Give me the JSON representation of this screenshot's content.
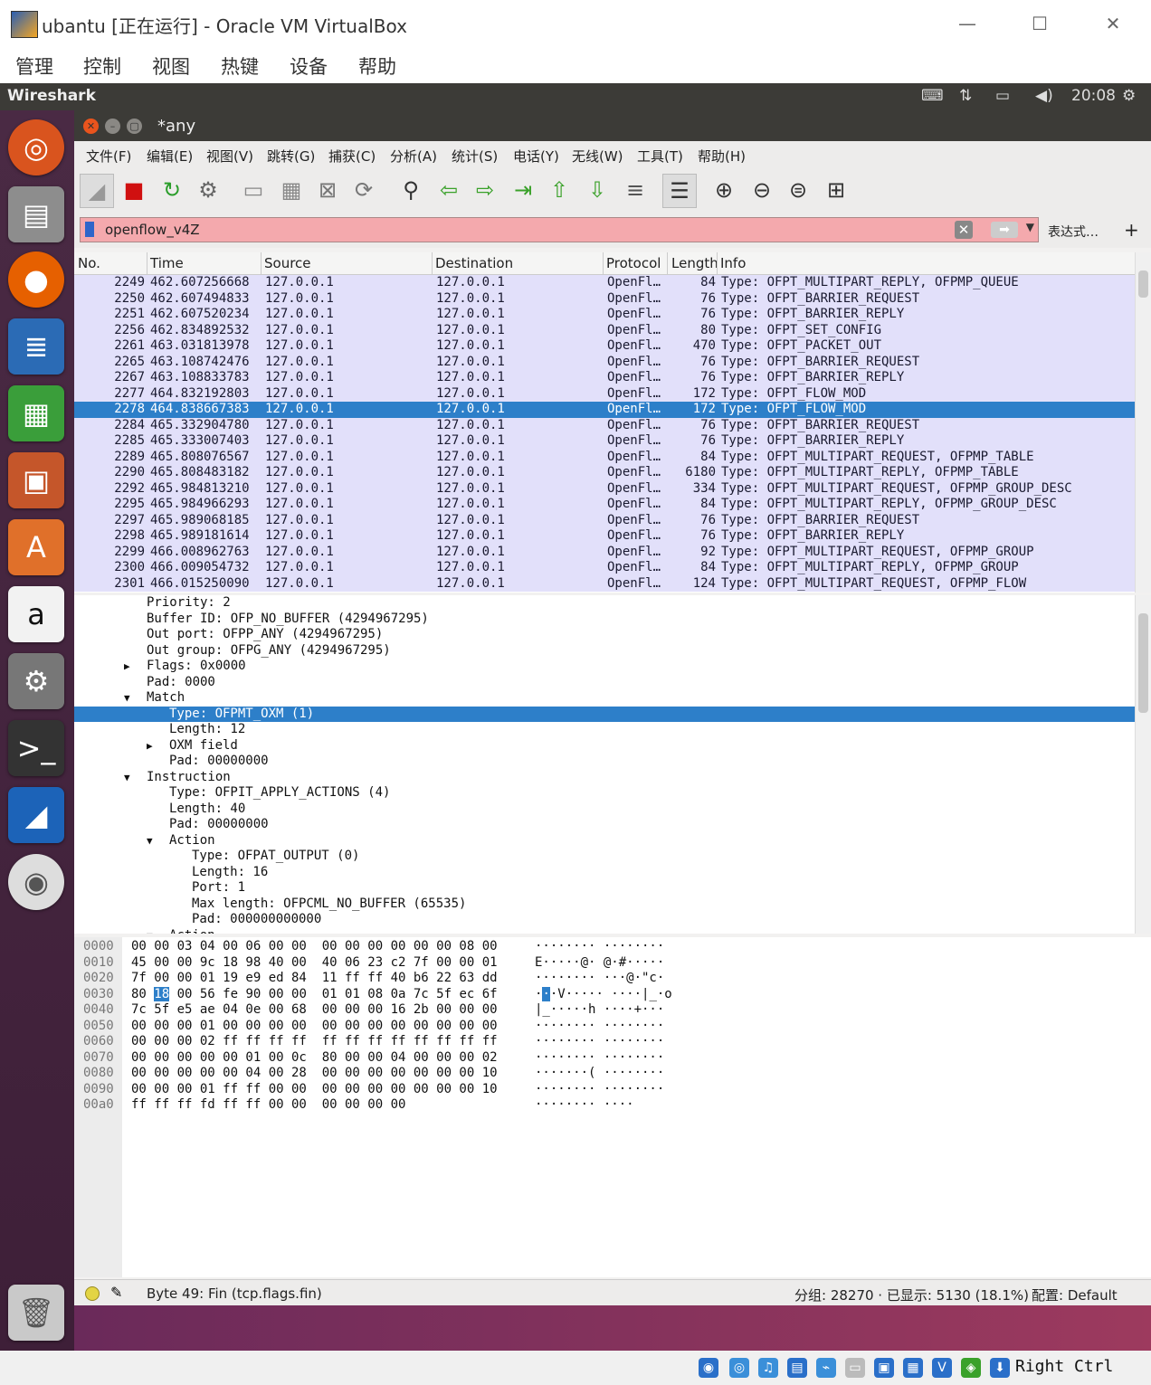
{
  "vbox": {
    "title": "ubantu [正在运行] - Oracle VM VirtualBox",
    "menu": [
      "管理",
      "控制",
      "视图",
      "热键",
      "设备",
      "帮助"
    ],
    "min": "—",
    "max": "☐",
    "close": "✕",
    "host_key": "Right Ctrl"
  },
  "ubuntu_panel": {
    "app_name": "Wireshark",
    "clock": "20:08",
    "indicators": [
      "keyboard-icon",
      "network-icon",
      "battery-icon",
      "volume-icon",
      "settings-icon"
    ]
  },
  "launcher": [
    "ubuntu-dash-icon",
    "files-icon",
    "firefox-icon",
    "writer-icon",
    "calc-icon",
    "impress-icon",
    "software-center-icon",
    "amazon-icon",
    "system-settings-icon",
    "terminal-icon",
    "wireshark-icon",
    "dvd-icon",
    "trash-icon"
  ],
  "wireshark": {
    "title": "*any",
    "menu": [
      "文件(F)",
      "编辑(E)",
      "视图(V)",
      "跳转(G)",
      "捕获(C)",
      "分析(A)",
      "统计(S)",
      "电话(Y)",
      "无线(W)",
      "工具(T)",
      "帮助(H)"
    ],
    "filter": {
      "value": "openflow_v4Z",
      "expression_label": "表达式…",
      "plus": "+"
    },
    "columns": [
      "No.",
      "Time",
      "Source",
      "Destination",
      "Protocol",
      "Length",
      "Info"
    ],
    "packets": [
      {
        "no": "2249",
        "time": "462.607256668",
        "src": "127.0.0.1",
        "dst": "127.0.0.1",
        "proto": "OpenFl…",
        "len": "84",
        "info": "Type: OFPT_MULTIPART_REPLY, OFPMP_QUEUE"
      },
      {
        "no": "2250",
        "time": "462.607494833",
        "src": "127.0.0.1",
        "dst": "127.0.0.1",
        "proto": "OpenFl…",
        "len": "76",
        "info": "Type: OFPT_BARRIER_REQUEST"
      },
      {
        "no": "2251",
        "time": "462.607520234",
        "src": "127.0.0.1",
        "dst": "127.0.0.1",
        "proto": "OpenFl…",
        "len": "76",
        "info": "Type: OFPT_BARRIER_REPLY"
      },
      {
        "no": "2256",
        "time": "462.834892532",
        "src": "127.0.0.1",
        "dst": "127.0.0.1",
        "proto": "OpenFl…",
        "len": "80",
        "info": "Type: OFPT_SET_CONFIG"
      },
      {
        "no": "2261",
        "time": "463.031813978",
        "src": "127.0.0.1",
        "dst": "127.0.0.1",
        "proto": "OpenFl…",
        "len": "470",
        "info": "Type: OFPT_PACKET_OUT"
      },
      {
        "no": "2265",
        "time": "463.108742476",
        "src": "127.0.0.1",
        "dst": "127.0.0.1",
        "proto": "OpenFl…",
        "len": "76",
        "info": "Type: OFPT_BARRIER_REQUEST"
      },
      {
        "no": "2267",
        "time": "463.108833783",
        "src": "127.0.0.1",
        "dst": "127.0.0.1",
        "proto": "OpenFl…",
        "len": "76",
        "info": "Type: OFPT_BARRIER_REPLY"
      },
      {
        "no": "2277",
        "time": "464.832192803",
        "src": "127.0.0.1",
        "dst": "127.0.0.1",
        "proto": "OpenFl…",
        "len": "172",
        "info": "Type: OFPT_FLOW_MOD"
      },
      {
        "no": "2278",
        "time": "464.838667383",
        "src": "127.0.0.1",
        "dst": "127.0.0.1",
        "proto": "OpenFl…",
        "len": "172",
        "info": "Type: OFPT_FLOW_MOD",
        "selected": true
      },
      {
        "no": "2284",
        "time": "465.332904780",
        "src": "127.0.0.1",
        "dst": "127.0.0.1",
        "proto": "OpenFl…",
        "len": "76",
        "info": "Type: OFPT_BARRIER_REQUEST"
      },
      {
        "no": "2285",
        "time": "465.333007403",
        "src": "127.0.0.1",
        "dst": "127.0.0.1",
        "proto": "OpenFl…",
        "len": "76",
        "info": "Type: OFPT_BARRIER_REPLY"
      },
      {
        "no": "2289",
        "time": "465.808076567",
        "src": "127.0.0.1",
        "dst": "127.0.0.1",
        "proto": "OpenFl…",
        "len": "84",
        "info": "Type: OFPT_MULTIPART_REQUEST, OFPMP_TABLE"
      },
      {
        "no": "2290",
        "time": "465.808483182",
        "src": "127.0.0.1",
        "dst": "127.0.0.1",
        "proto": "OpenFl…",
        "len": "6180",
        "info": "Type: OFPT_MULTIPART_REPLY, OFPMP_TABLE"
      },
      {
        "no": "2292",
        "time": "465.984813210",
        "src": "127.0.0.1",
        "dst": "127.0.0.1",
        "proto": "OpenFl…",
        "len": "334",
        "info": "Type: OFPT_MULTIPART_REQUEST, OFPMP_GROUP_DESC"
      },
      {
        "no": "2295",
        "time": "465.984966293",
        "src": "127.0.0.1",
        "dst": "127.0.0.1",
        "proto": "OpenFl…",
        "len": "84",
        "info": "Type: OFPT_MULTIPART_REPLY, OFPMP_GROUP_DESC"
      },
      {
        "no": "2297",
        "time": "465.989068185",
        "src": "127.0.0.1",
        "dst": "127.0.0.1",
        "proto": "OpenFl…",
        "len": "76",
        "info": "Type: OFPT_BARRIER_REQUEST"
      },
      {
        "no": "2298",
        "time": "465.989181614",
        "src": "127.0.0.1",
        "dst": "127.0.0.1",
        "proto": "OpenFl…",
        "len": "76",
        "info": "Type: OFPT_BARRIER_REPLY"
      },
      {
        "no": "2299",
        "time": "466.008962763",
        "src": "127.0.0.1",
        "dst": "127.0.0.1",
        "proto": "OpenFl…",
        "len": "92",
        "info": "Type: OFPT_MULTIPART_REQUEST, OFPMP_GROUP"
      },
      {
        "no": "2300",
        "time": "466.009054732",
        "src": "127.0.0.1",
        "dst": "127.0.0.1",
        "proto": "OpenFl…",
        "len": "84",
        "info": "Type: OFPT_MULTIPART_REPLY, OFPMP_GROUP"
      },
      {
        "no": "2301",
        "time": "466.015250090",
        "src": "127.0.0.1",
        "dst": "127.0.0.1",
        "proto": "OpenFl…",
        "len": "124",
        "info": "Type: OFPT_MULTIPART_REQUEST, OFPMP_FLOW"
      }
    ],
    "details": [
      {
        "indent": 2,
        "text": "Priority: 2"
      },
      {
        "indent": 2,
        "text": "Buffer ID: OFP_NO_BUFFER (4294967295)"
      },
      {
        "indent": 2,
        "text": "Out port: OFPP_ANY (4294967295)"
      },
      {
        "indent": 2,
        "text": "Out group: OFPG_ANY (4294967295)"
      },
      {
        "indent": 2,
        "text": "Flags: 0x0000",
        "arrow": "▶"
      },
      {
        "indent": 2,
        "text": "Pad: 0000"
      },
      {
        "indent": 2,
        "text": "Match",
        "arrow": "▼"
      },
      {
        "indent": 3,
        "text": "Type: OFPMT_OXM (1)",
        "selected": true
      },
      {
        "indent": 3,
        "text": "Length: 12"
      },
      {
        "indent": 3,
        "text": "OXM field",
        "arrow": "▶"
      },
      {
        "indent": 3,
        "text": "Pad: 00000000"
      },
      {
        "indent": 2,
        "text": "Instruction",
        "arrow": "▼"
      },
      {
        "indent": 3,
        "text": "Type: OFPIT_APPLY_ACTIONS (4)"
      },
      {
        "indent": 3,
        "text": "Length: 40"
      },
      {
        "indent": 3,
        "text": "Pad: 00000000"
      },
      {
        "indent": 3,
        "text": "Action",
        "arrow": "▼"
      },
      {
        "indent": 4,
        "text": "Type: OFPAT_OUTPUT (0)"
      },
      {
        "indent": 4,
        "text": "Length: 16"
      },
      {
        "indent": 4,
        "text": "Port: 1"
      },
      {
        "indent": 4,
        "text": "Max length: OFPCML_NO_BUFFER (65535)"
      },
      {
        "indent": 4,
        "text": "Pad: 000000000000"
      },
      {
        "indent": 3,
        "text": "Action",
        "arrow": "▼"
      }
    ],
    "bytes": [
      {
        "off": "0000",
        "hex": "00 00 03 04 00 06 00 00  00 00 00 00 00 00 08 00",
        "asc": "········ ········"
      },
      {
        "off": "0010",
        "hex": "45 00 00 9c 18 98 40 00  40 06 23 c2 7f 00 00 01",
        "asc": "E·····@· @·#·····"
      },
      {
        "off": "0020",
        "hex": "7f 00 00 01 19 e9 ed 84  11 ff ff 40 b6 22 63 dd",
        "asc": "········ ···@·\"c·"
      },
      {
        "off": "0030",
        "hex_pre": "80 ",
        "hex_hl": "18",
        "hex_post": " 00 56 fe 90 00 00  01 01 08 0a 7c 5f ec 6f",
        "asc_pre": "·",
        "asc_hl": "·",
        "asc_post": "·V····· ····|_·o"
      },
      {
        "off": "0040",
        "hex": "7c 5f e5 ae 04 0e 00 68  00 00 00 16 2b 00 00 00",
        "asc": "|_·····h ····+···"
      },
      {
        "off": "0050",
        "hex": "00 00 00 01 00 00 00 00  00 00 00 00 00 00 00 00",
        "asc": "········ ········"
      },
      {
        "off": "0060",
        "hex": "00 00 00 02 ff ff ff ff  ff ff ff ff ff ff ff ff",
        "asc": "········ ········"
      },
      {
        "off": "0070",
        "hex": "00 00 00 00 00 01 00 0c  80 00 00 04 00 00 00 02",
        "asc": "········ ········"
      },
      {
        "off": "0080",
        "hex": "00 00 00 00 00 04 00 28  00 00 00 00 00 00 00 10",
        "asc": "·······( ········"
      },
      {
        "off": "0090",
        "hex": "00 00 00 01 ff ff 00 00  00 00 00 00 00 00 00 10",
        "asc": "········ ········"
      },
      {
        "off": "00a0",
        "hex": "ff ff ff fd ff ff 00 00  00 00 00 00",
        "asc": "········ ····"
      }
    ],
    "status": {
      "field": "Byte 49: Fin (tcp.flags.fin)",
      "packets": "分组: 28270 · 已显示: 5130 (18.1%)",
      "profile": "配置: Default"
    }
  },
  "colors": {
    "selected": "#2d7fc9",
    "row_bg": "#e2e0fa",
    "filter_bg": "#f4a9ad"
  }
}
